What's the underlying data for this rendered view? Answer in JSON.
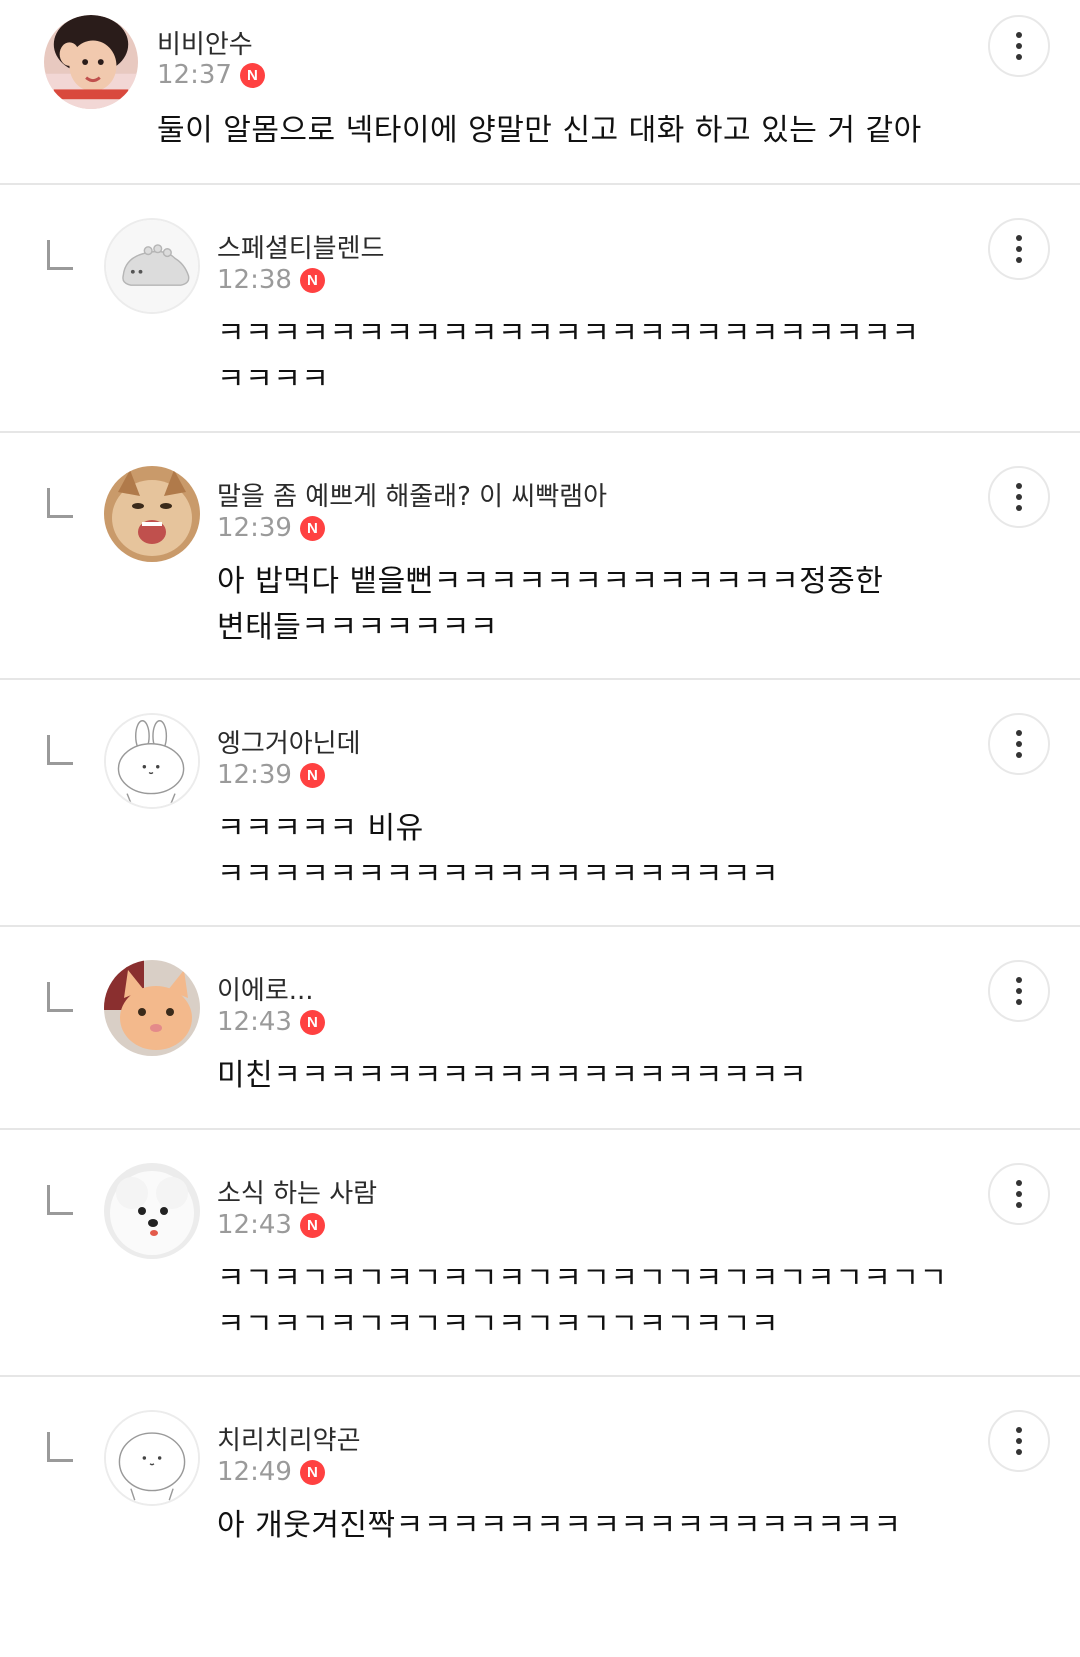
{
  "comments": [
    {
      "author": "비비안수",
      "time": "12:37",
      "badge": "N",
      "text": "둘이 알몸으로 넥타이에 양말만 신고 대화 하고 있는 거 같아",
      "avatar_icon": "girl-photo-avatar",
      "is_reply": false
    },
    {
      "author": "스페셜티블렌드",
      "time": "12:38",
      "badge": "N",
      "text": "ㅋㅋㅋㅋㅋㅋㅋㅋㅋㅋㅋㅋㅋㅋㅋㅋㅋㅋㅋㅋㅋㅋㅋㅋㅋ\nㅋㅋㅋㅋ",
      "avatar_icon": "default-dino-avatar",
      "is_reply": true
    },
    {
      "author": "말을 좀 예쁘게 해줄래? 이 씨빡램아",
      "time": "12:39",
      "badge": "N",
      "text": "아 밥먹다 뱉을뻔ㅋㅋㅋㅋㅋㅋㅋㅋㅋㅋㅋㅋㅋ정중한\n변태들ㅋㅋㅋㅋㅋㅋㅋ",
      "avatar_icon": "cat-photo-avatar",
      "is_reply": true
    },
    {
      "author": "엥그거아닌데",
      "time": "12:39",
      "badge": "N",
      "text": "ㅋㅋㅋㅋㅋ 비유\nㅋㅋㅋㅋㅋㅋㅋㅋㅋㅋㅋㅋㅋㅋㅋㅋㅋㅋㅋㅋ",
      "avatar_icon": "default-rabbit-avatar",
      "is_reply": true
    },
    {
      "author": "이에로...",
      "time": "12:43",
      "badge": "N",
      "text": "미친ㅋㅋㅋㅋㅋㅋㅋㅋㅋㅋㅋㅋㅋㅋㅋㅋㅋㅋㅋ",
      "avatar_icon": "cat-photo-avatar-2",
      "is_reply": true
    },
    {
      "author": "소식 하는 사람",
      "time": "12:43",
      "badge": "N",
      "text": "ㅋㄱㅋㄱㅋㄱㅋㄱㅋㄱㅋㄱㅋㄱㅋㄱㄱㅋㄱㅋㄱㅋㄱㅋㄱㄱ\nㅋㄱㅋㄱㅋㄱㅋㄱㅋㄱㅋㄱㅋㄱㄱㅋㄱㅋㄱㅋ",
      "avatar_icon": "dog-photo-avatar",
      "is_reply": true
    },
    {
      "author": "치리치리약곤",
      "time": "12:49",
      "badge": "N",
      "text": "아 개웃겨진짝ㅋㅋㅋㅋㅋㅋㅋㅋㅋㅋㅋㅋㅋㅋㅋㅋㅋㅋ",
      "avatar_icon": "default-blob-avatar",
      "is_reply": true
    }
  ],
  "more_button_icon": "more-vertical-icon",
  "reply_icon": "reply-corner-icon"
}
